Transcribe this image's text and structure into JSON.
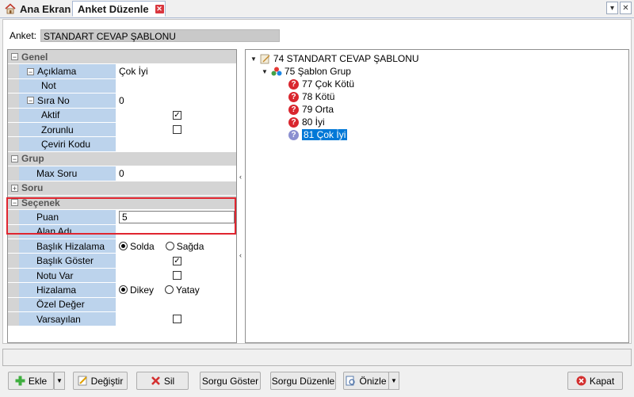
{
  "tabs": [
    {
      "label": "Ana Ekran",
      "icon": "home-icon"
    },
    {
      "label": "Anket Düzenle",
      "icon": "close-icon"
    }
  ],
  "anket": {
    "label": "Anket:",
    "value": "STANDART CEVAP ŞABLONU"
  },
  "categories": {
    "genel": "Genel",
    "grup": "Grup",
    "soru": "Soru",
    "secenek": "Seçenek"
  },
  "props": {
    "aciklama": {
      "name": "Açıklama",
      "value": "Çok İyi"
    },
    "not": {
      "name": "Not",
      "value": ""
    },
    "sirano": {
      "name": "Sıra No",
      "value": "0"
    },
    "aktif": {
      "name": "Aktif",
      "checked": true
    },
    "zorunlu": {
      "name": "Zorunlu",
      "checked": false
    },
    "ceviri": {
      "name": "Çeviri Kodu",
      "value": ""
    },
    "maxsoru": {
      "name": "Max Soru",
      "value": "0"
    },
    "puan": {
      "name": "Puan",
      "value": "5"
    },
    "alanadi": {
      "name": "Alan Adı",
      "value": ""
    },
    "baslikhizalama": {
      "name": "Başlık Hizalama",
      "opt1": "Solda",
      "opt2": "Sağda",
      "selected": "Solda"
    },
    "baslikgoster": {
      "name": "Başlık Göster",
      "checked": true
    },
    "notuvar": {
      "name": "Notu Var",
      "checked": false
    },
    "hizalama": {
      "name": "Hizalama",
      "opt1": "Dikey",
      "opt2": "Yatay",
      "selected": "Dikey"
    },
    "ozeldeger": {
      "name": "Özel Değer",
      "value": ""
    },
    "varsayilan": {
      "name": "Varsayılan",
      "checked": false
    }
  },
  "tree": {
    "root": "74 STANDART CEVAP ŞABLONU",
    "group": "75 Şablon Grup",
    "items": [
      "77 Çok Kötü",
      "78 Kötü",
      "79 Orta",
      "80 İyi",
      "81 Çok İyi"
    ],
    "selected_index": 4
  },
  "buttons": {
    "ekle": "Ekle",
    "degistir": "Değiştir",
    "sil": "Sil",
    "sorgu_goster": "Sorgu Göster",
    "sorgu_duzenle": "Sorgu Düzenle",
    "onizle": "Önizle",
    "kapat": "Kapat"
  },
  "colors": {
    "accent": "#0078d7",
    "highlight": "#e0252f",
    "name_cell": "#bcd3ec"
  }
}
